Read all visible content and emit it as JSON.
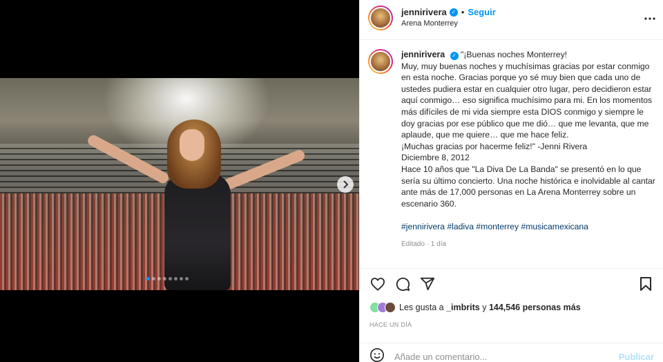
{
  "post": {
    "username": "jennirivera",
    "follow_label": "Seguir",
    "separator": "•",
    "location": "Arena Monterrey",
    "more_icon": "more-horizontal-icon"
  },
  "caption": {
    "username": "jennirivera",
    "lines": [
      "\"¡Buenas noches Monterrey!",
      "Muy, muy buenas noches y muchísimas gracias por estar conmigo en esta noche. Gracias porque yo sé muy bien que cada uno de ustedes pudiera estar en cualquier otro lugar, pero decidieron estar aquí conmigo… eso significa muchísimo para mi. En los momentos más difíciles de mi vida siempre esta DIOS conmigo y siempre le doy gracias por ese público que me dió… que me levanta, que me aplaude, que me quiere… que me hace feliz.",
      "¡Muchas gracias por hacerme feliz!\" -Jenni Rivera",
      "Diciembre 8, 2012",
      "Hace 10 años que \"La Diva De La Banda\" se presentó en lo que sería su último concierto. Una noche histórica e inolvidable al cantar ante más de 17,000 personas en La Arena Monterrey sobre un escenario 360."
    ],
    "hashtags": "#jennirivera #ladiva #monterrey #musicamexicana",
    "edited": "Editado · 1 día"
  },
  "media": {
    "carousel_count": 8,
    "carousel_active": 1
  },
  "likes": {
    "prefix": "Les gusta a ",
    "user": "_imbrits",
    "middle": " y ",
    "count": "144,546 personas más"
  },
  "time_ago": "HACE UN DÍA",
  "comment": {
    "placeholder": "Añade un comentario...",
    "publish_label": "Publicar"
  },
  "colors": {
    "accent": "#0095f6",
    "hashtag": "#00376b",
    "muted": "#8e8e8e",
    "publish_disabled": "#b2dffc"
  }
}
